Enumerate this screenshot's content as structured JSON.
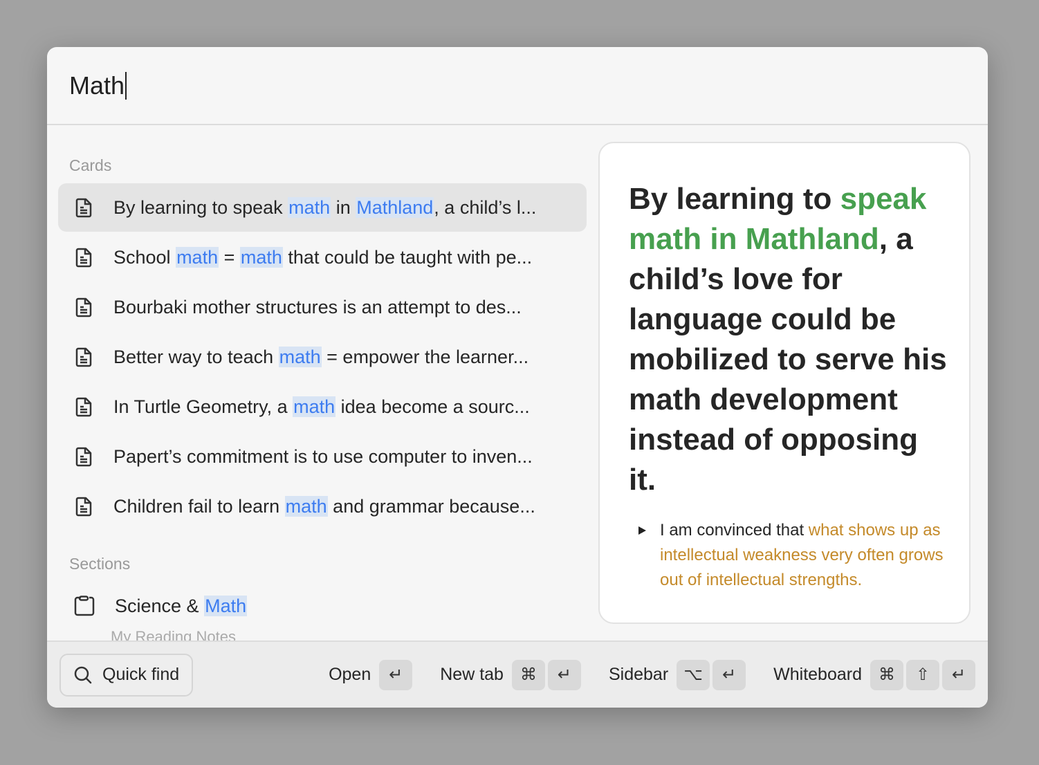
{
  "search": {
    "value": "Math"
  },
  "left": {
    "cards_label": "Cards",
    "cards": [
      {
        "selected": true,
        "segments": [
          {
            "t": "By learning to speak "
          },
          {
            "t": "math",
            "h": true
          },
          {
            "t": " in "
          },
          {
            "t": "Mathland",
            "h": true
          },
          {
            "t": ", a child’s l..."
          }
        ]
      },
      {
        "segments": [
          {
            "t": "School "
          },
          {
            "t": "math",
            "h": true
          },
          {
            "t": " = "
          },
          {
            "t": "math",
            "h": true
          },
          {
            "t": " that could be taught with pe..."
          }
        ]
      },
      {
        "segments": [
          {
            "t": "Bourbaki mother structures is an attempt to des..."
          }
        ]
      },
      {
        "segments": [
          {
            "t": "Better way to teach "
          },
          {
            "t": "math",
            "h": true
          },
          {
            "t": " = empower the learner..."
          }
        ]
      },
      {
        "segments": [
          {
            "t": "In Turtle Geometry, a "
          },
          {
            "t": "math",
            "h": true
          },
          {
            "t": " idea become a sourc..."
          }
        ]
      },
      {
        "segments": [
          {
            "t": "Papert’s commitment is to use computer to inven..."
          }
        ]
      },
      {
        "segments": [
          {
            "t": "Children fail to learn "
          },
          {
            "t": "math",
            "h": true
          },
          {
            "t": " and grammar because..."
          }
        ]
      }
    ],
    "sections_label": "Sections",
    "sections": [
      {
        "segments": [
          {
            "t": "Science & "
          },
          {
            "t": "Math",
            "h": true
          }
        ],
        "subtitle": "My Reading Notes"
      }
    ]
  },
  "preview": {
    "title": [
      {
        "t": "By learning to "
      },
      {
        "t": "speak math in Mathland",
        "g": true
      },
      {
        "t": ", a child’s love for language could be mobilized to serve his math development instead of opposing it."
      }
    ],
    "bullet": [
      {
        "t": "I am convinced that "
      },
      {
        "t": "what shows up as intellectual weakness very often grows out of intellectual strengths.",
        "o": true
      }
    ]
  },
  "footer": {
    "quick_find": "Quick find",
    "actions": [
      {
        "label": "Open",
        "keys": [
          "↵"
        ]
      },
      {
        "label": "New tab",
        "keys": [
          "⌘",
          "↵"
        ]
      },
      {
        "label": "Sidebar",
        "keys": [
          "⌥",
          "↵"
        ]
      },
      {
        "label": "Whiteboard",
        "keys": [
          "⌘",
          "⇧",
          "↵"
        ]
      }
    ]
  },
  "colors": {
    "highlight": "#3d7cf0",
    "green": "#47a04f",
    "orange": "#c48a2a"
  }
}
